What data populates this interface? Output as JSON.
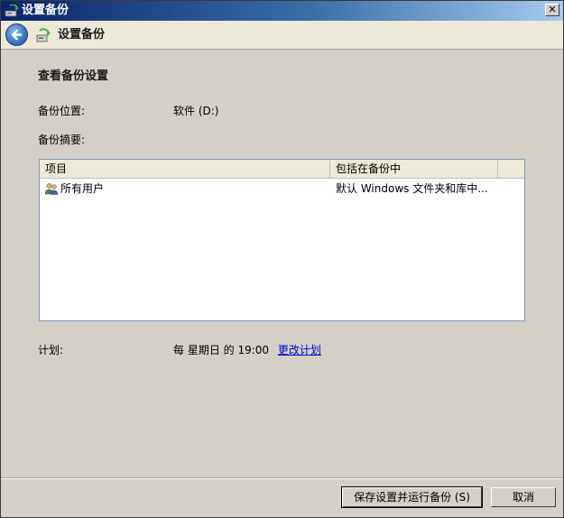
{
  "window": {
    "title": "设置备份",
    "close_label": "✕"
  },
  "nav": {
    "title": "设置备份"
  },
  "content": {
    "heading": "查看备份设置",
    "location_label": "备份位置:",
    "location_value": "软件 (D:)",
    "summary_label": "备份摘要:",
    "table": {
      "columns": [
        "项目",
        "包括在备份中"
      ],
      "rows": [
        {
          "item": "所有用户",
          "included": "默认 Windows 文件夹和库中..."
        }
      ]
    },
    "schedule_label": "计划:",
    "schedule_value": "每 星期日 的 19:00",
    "schedule_link": "更改计划"
  },
  "buttons": {
    "save_run": "保存设置并运行备份 (S)",
    "cancel": "取消"
  }
}
